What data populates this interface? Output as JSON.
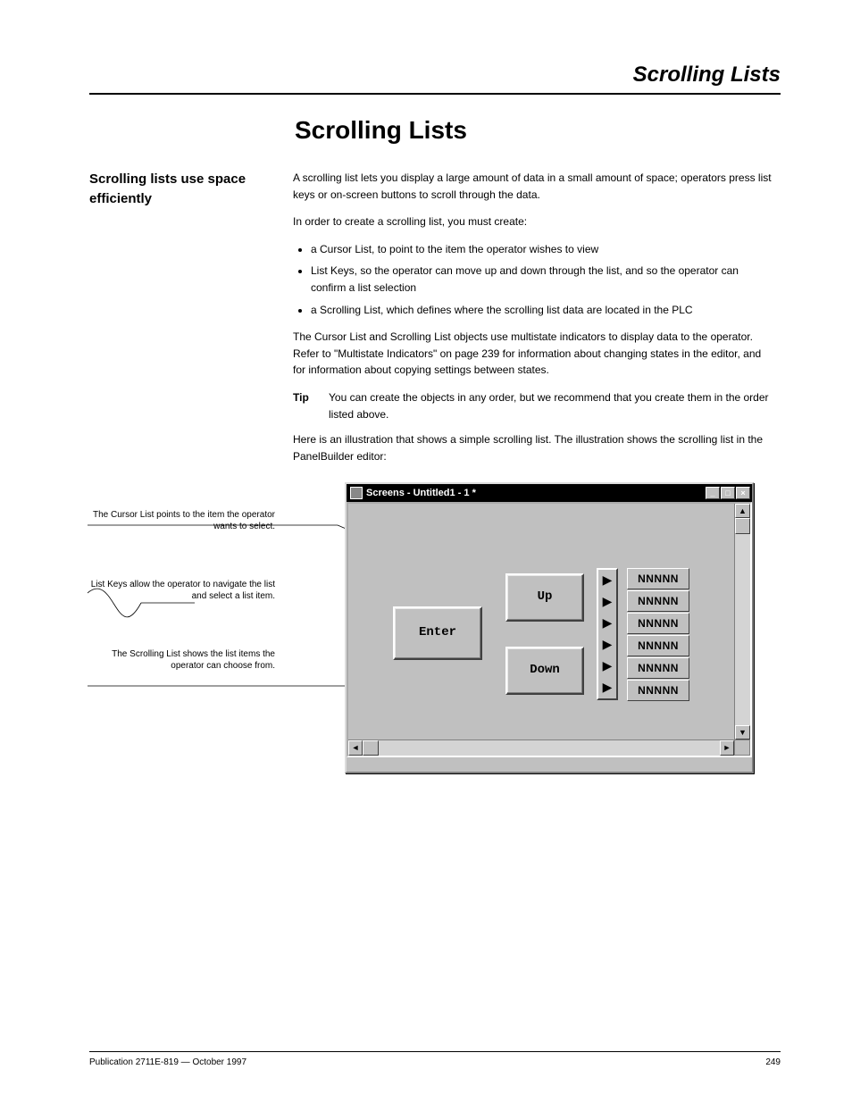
{
  "running_head": "Scrolling Lists",
  "title": "Scrolling Lists",
  "left_col": {
    "sec": "Scrolling lists use space efficiently"
  },
  "right_col": {
    "p1": "A scrolling list lets you display a large amount of data in a small amount of space; operators press list keys or on-screen buttons to scroll through the data.",
    "p2": "In order to create a scrolling list, you must create:",
    "b1": "a Cursor List, to point to the item the operator wishes to view",
    "b2": "List Keys, so the operator can move up and down through the list, and so the operator can confirm a list selection",
    "b3": "a Scrolling List, which defines where the scrolling list data are located in the PLC",
    "p3": "The Cursor List and Scrolling List objects use multistate indicators to display data to the operator. Refer to \"Multistate Indicators\" on page 239 for information about changing states in the editor, and for information about copying settings between states.",
    "tip_lbl": "Tip",
    "tip_txt": "You can create the objects in any order, but we recommend that you create them in the order listed above.",
    "p4": "Here is an illustration that shows a simple scrolling list. The illustration shows the scrolling list in the PanelBuilder editor:"
  },
  "callouts": {
    "c1": "The Cursor List points to the item the operator wants to select.",
    "c2": "List Keys allow the operator to navigate the list and select a list item.",
    "c3": "The Scrolling List shows the list items the operator can choose from."
  },
  "window": {
    "title": "Screens - Untitled1 -   1 *",
    "min": "_",
    "max": "□",
    "close": "×",
    "enter": "Enter",
    "up": "Up",
    "down": "Down",
    "cells": [
      "NNNNN",
      "NNNNN",
      "NNNNN",
      "NNNNN",
      "NNNNN",
      "NNNNN"
    ],
    "v_up": "▲",
    "v_down": "▼",
    "h_left": "◄",
    "h_right": "►",
    "arrow": "▶"
  },
  "footer": {
    "left": "Publication 2711E-819 — October 1997",
    "right": "249"
  }
}
